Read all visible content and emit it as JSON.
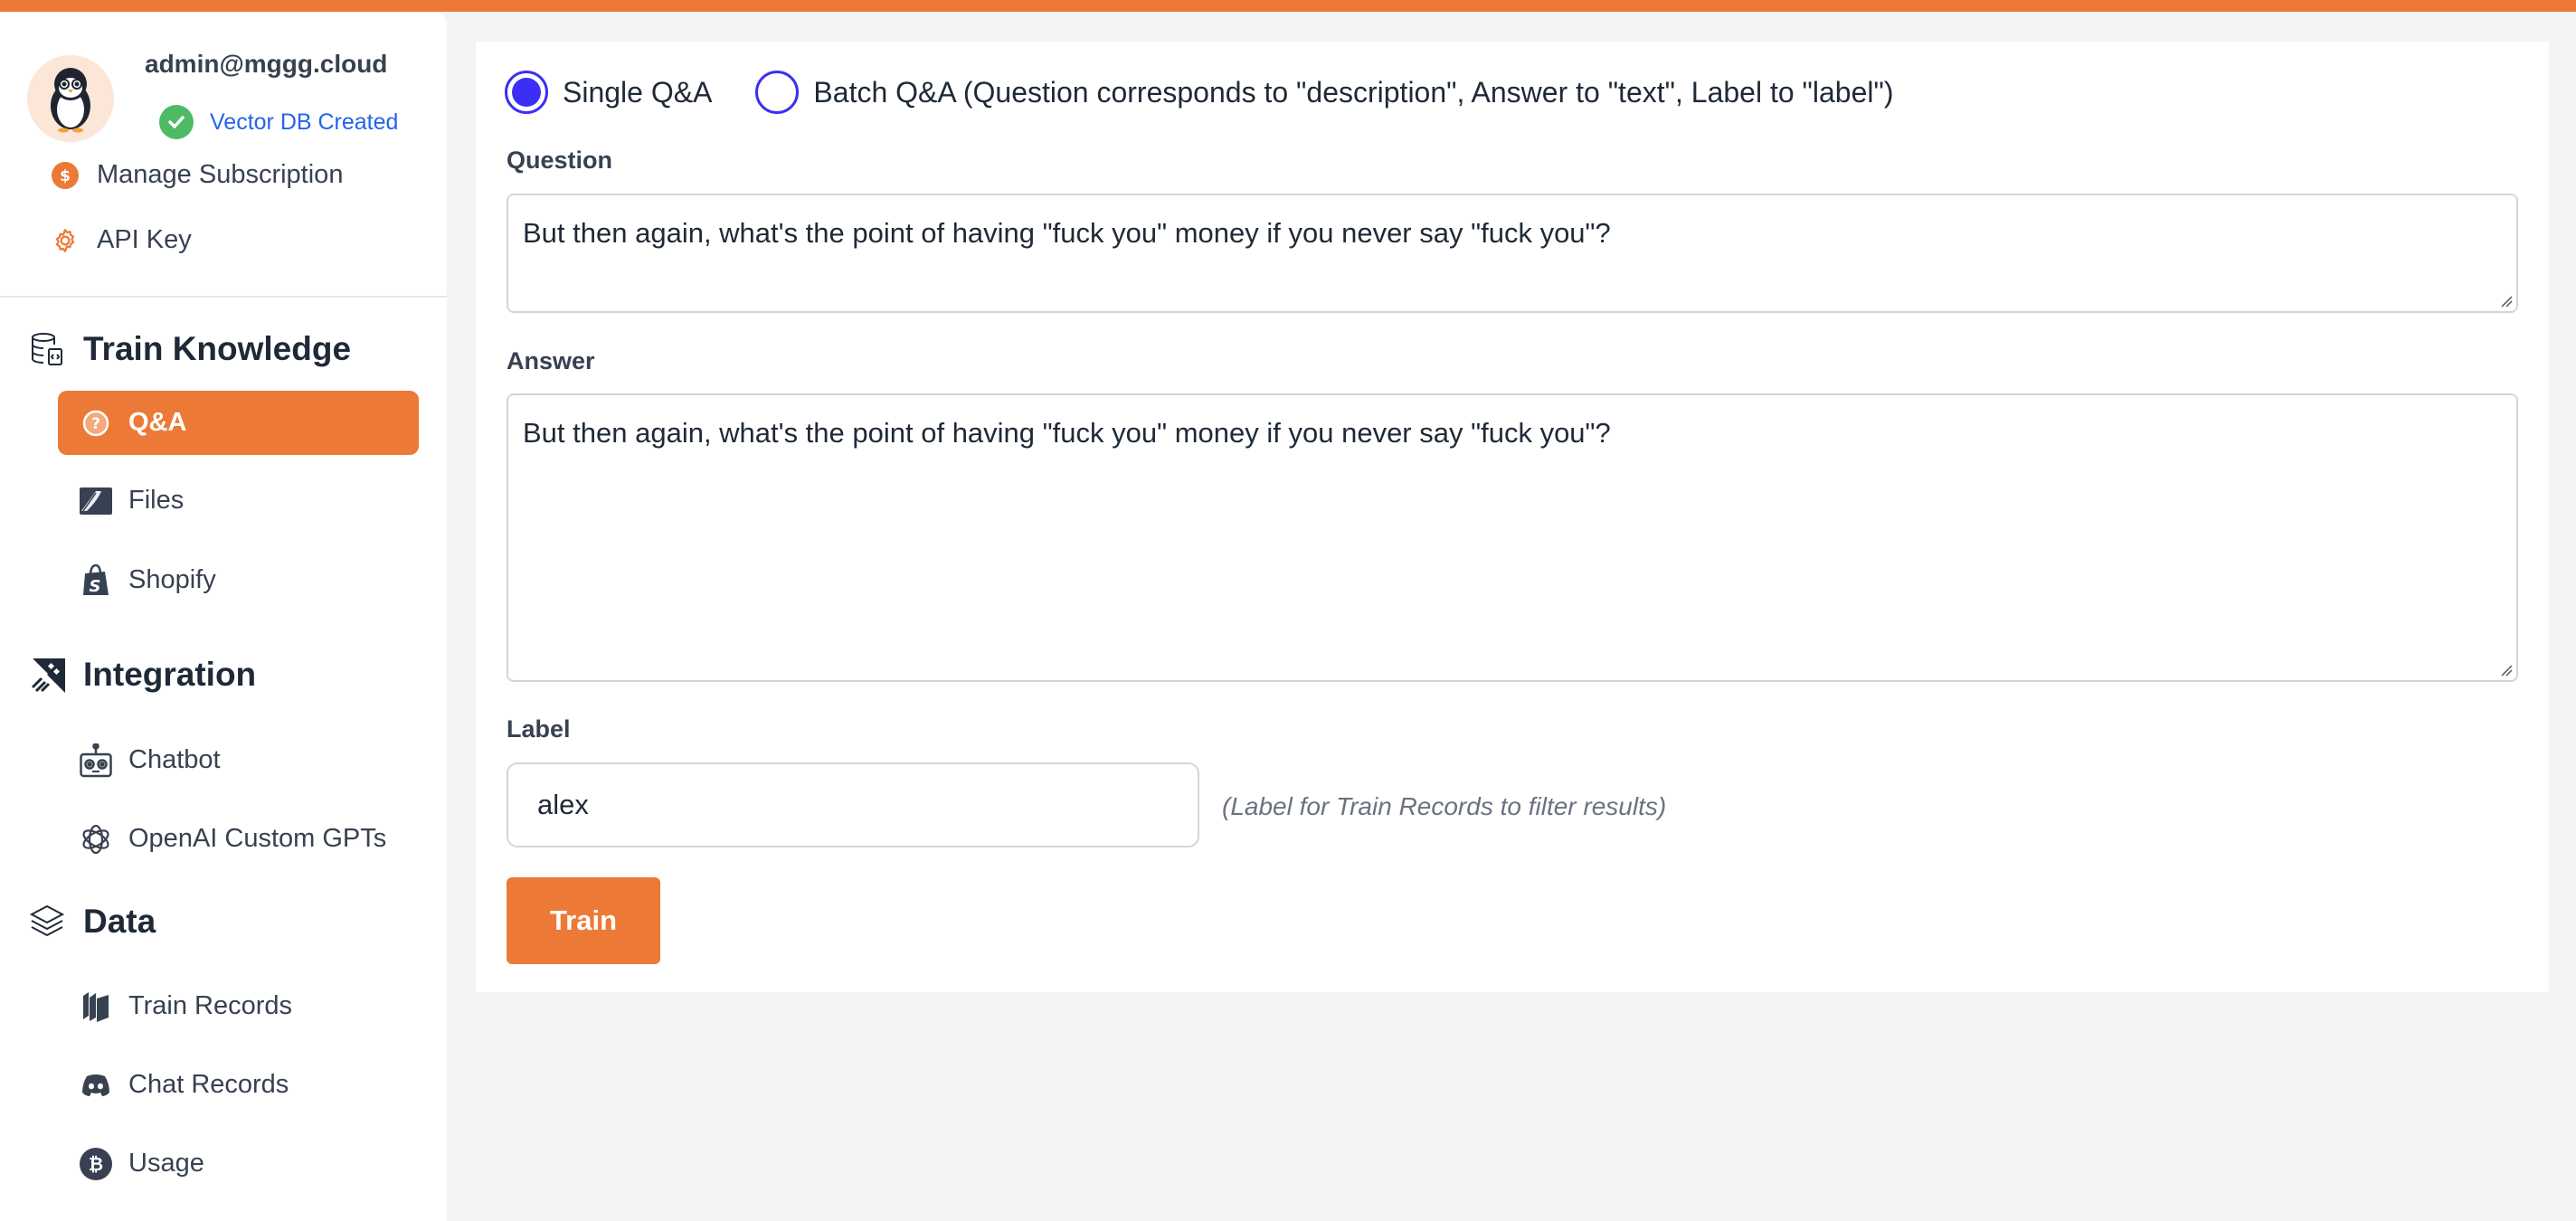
{
  "colors": {
    "accent": "#ec7a36",
    "radio": "#3b2ff5",
    "success": "#4cbb64",
    "link": "#2563eb"
  },
  "account": {
    "avatar_icon": "penguin-avatar",
    "email": "admin@mggg.cloud",
    "vector_db_status": "Vector DB Created",
    "vector_db_icon": "check-circle-icon",
    "items": [
      {
        "label": "Manage Subscription",
        "icon": "dollar-circle-icon"
      },
      {
        "label": "API Key",
        "icon": "gear-icon"
      }
    ]
  },
  "sidebar": {
    "sections": [
      {
        "title": "Train Knowledge",
        "icon": "database-code-icon",
        "items": [
          {
            "label": "Q&A",
            "icon": "question-circle-icon",
            "active": true
          },
          {
            "label": "Files",
            "icon": "file-icon",
            "active": false
          },
          {
            "label": "Shopify",
            "icon": "shopify-bag-icon",
            "active": false
          }
        ]
      },
      {
        "title": "Integration",
        "icon": "rocket-icon",
        "items": [
          {
            "label": "Chatbot",
            "icon": "robot-icon",
            "active": false
          },
          {
            "label": "OpenAI Custom GPTs",
            "icon": "openai-icon",
            "active": false
          }
        ]
      },
      {
        "title": "Data",
        "icon": "layers-icon",
        "items": [
          {
            "label": "Train Records",
            "icon": "books-icon",
            "active": false
          },
          {
            "label": "Chat Records",
            "icon": "discord-icon",
            "active": false
          },
          {
            "label": "Usage",
            "icon": "bitcoin-icon",
            "active": false
          }
        ]
      }
    ]
  },
  "form": {
    "mode_options": [
      {
        "label": "Single Q&A",
        "selected": true
      },
      {
        "label": "Batch Q&A (Question corresponds to \"description\", Answer to \"text\", Label to \"label\")",
        "selected": false
      }
    ],
    "question": {
      "label": "Question",
      "value": "But then again, what's the point of having \"fuck you\" money if you never say \"fuck you\"?"
    },
    "answer": {
      "label": "Answer",
      "value": "But then again, what's the point of having \"fuck you\" money if you never say \"fuck you\"?"
    },
    "label_field": {
      "label": "Label",
      "value": "alex",
      "hint": "(Label for Train Records to filter results)"
    },
    "submit_label": "Train"
  }
}
